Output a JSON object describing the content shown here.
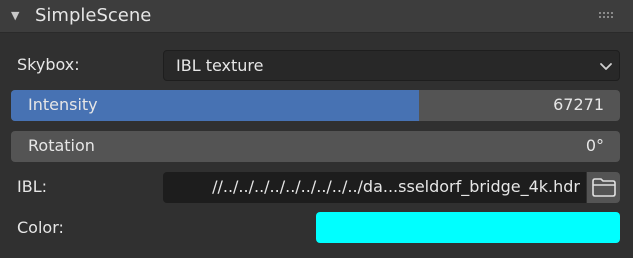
{
  "panel": {
    "title": "SimpleScene",
    "collapse_icon": "triangle-down-icon",
    "drag_icon": "grip-dots-icon"
  },
  "skybox": {
    "label": "Skybox:",
    "selected": "IBL texture",
    "dropdown_icon": "chevron-down-icon"
  },
  "intensity": {
    "label": "Intensity",
    "value": "67271",
    "fill_fraction": 0.67
  },
  "rotation": {
    "label": "Rotation",
    "value": "0°"
  },
  "ibl": {
    "label": "IBL:",
    "path": "//../../../../../../../../../da...sseldorf_bridge_4k.hdr",
    "browse_icon": "folder-icon"
  },
  "color": {
    "label": "Color:",
    "value_hex": "#00ffff"
  },
  "colors": {
    "accent": "#4772b3",
    "slider_bg": "#545454",
    "field_bg": "#1d1d1d",
    "panel_bg": "#303030"
  }
}
